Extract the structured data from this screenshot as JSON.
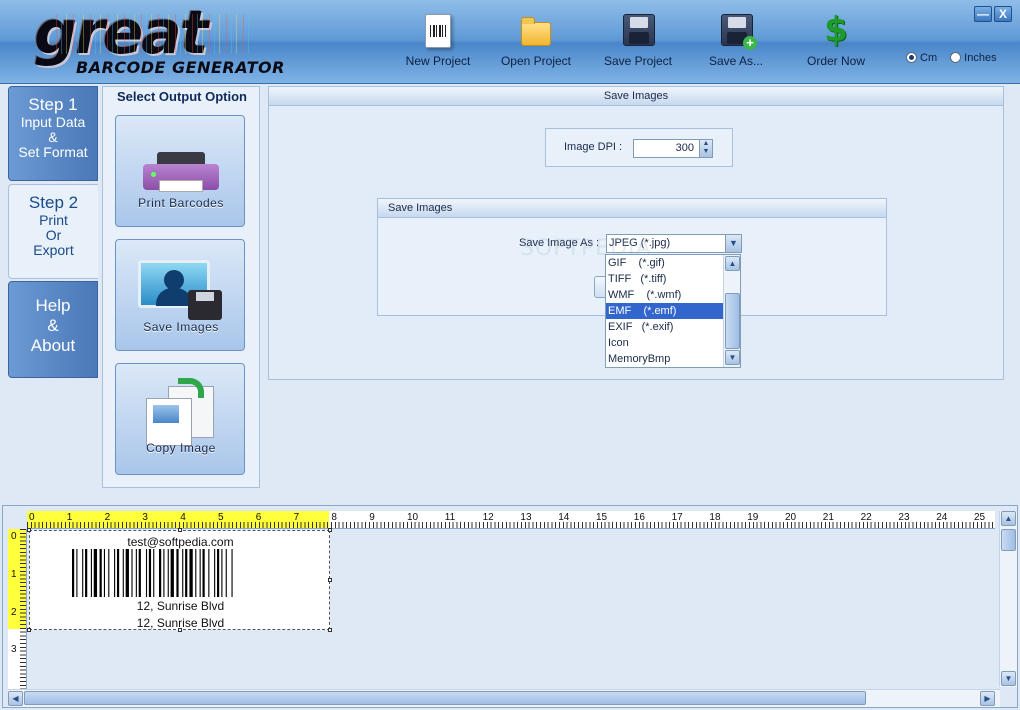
{
  "app": {
    "logo_main": "great",
    "logo_sub": "BARCODE GENERATOR"
  },
  "toolbar": [
    {
      "label": "New  Project",
      "icon": "new-project-icon"
    },
    {
      "label": "Open  Project",
      "icon": "open-folder-icon"
    },
    {
      "label": "Save Project",
      "icon": "floppy-disk-icon"
    },
    {
      "label": "Save As...",
      "icon": "save-as-icon"
    },
    {
      "label": "Order Now",
      "icon": "dollar-icon"
    }
  ],
  "units": {
    "options": [
      "Cm",
      "Inches"
    ],
    "selected": "Cm"
  },
  "window_buttons": {
    "minimize": "—",
    "close": "X"
  },
  "steps": [
    {
      "title": "Step 1",
      "lines": [
        "Input Data",
        "&",
        "Set Format"
      ],
      "active": false
    },
    {
      "title": "Step 2",
      "lines": [
        "Print",
        "Or",
        "Export"
      ],
      "active": true
    },
    {
      "title": "Help",
      "lines": [
        "&",
        "About"
      ],
      "active": false
    }
  ],
  "output": {
    "title": "Select Output Option",
    "buttons": [
      {
        "label": "Print Barcodes",
        "icon": "printer-icon"
      },
      {
        "label": "Save Images",
        "icon": "save-image-icon"
      },
      {
        "label": "Copy Image",
        "icon": "copy-image-icon"
      }
    ]
  },
  "main": {
    "panel_title": "Save Images",
    "dpi_label": "Image DPI :",
    "dpi_value": "300",
    "group_title": "Save Images",
    "save_as_label": "Save Image As :",
    "save_as_value": "JPEG  (*.jpg)",
    "format_options": [
      "GIF    (*.gif)",
      "TIFF   (*.tiff)",
      "WMF    (*.wmf)",
      "EMF    (*.emf)",
      "EXIF   (*.exif)",
      "Icon",
      "MemoryBmp"
    ],
    "selected_option_index": 3,
    "watermark": "SOFTPEDIA"
  },
  "ruler": {
    "h_numbers": [
      "0",
      "1",
      "2",
      "3",
      "4",
      "5",
      "6",
      "7",
      "8",
      "9",
      "10",
      "11",
      "12",
      "13",
      "14",
      "15",
      "16",
      "17",
      "18",
      "19",
      "20",
      "21",
      "22",
      "23",
      "24",
      "25"
    ],
    "v_numbers": [
      "0",
      "1",
      "2",
      "3"
    ]
  },
  "label": {
    "top_text": "test@softpedia.com",
    "middle_text": "12, Sunrise Blvd",
    "bottom_text": "12, Sunrise Blvd"
  },
  "colors": {
    "header_blue": "#5f9ad6",
    "ruler_yellow": "#ffff3c",
    "selection_blue": "#3366cc"
  }
}
